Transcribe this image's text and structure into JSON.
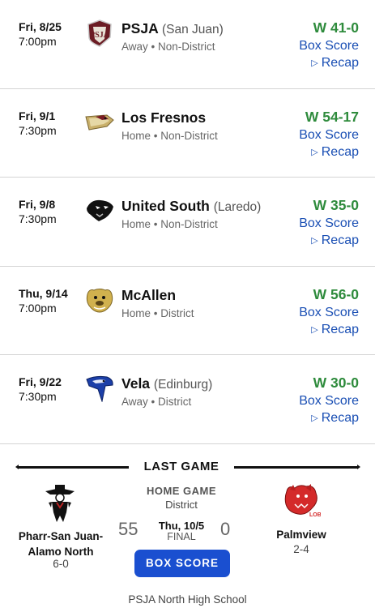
{
  "games": [
    {
      "date": "Fri, 8/25",
      "time": "7:00pm",
      "logo_icon": "psja-bearkat-icon",
      "opponent": "PSJA",
      "city": "(San Juan)",
      "details": "Away • Non-District",
      "result": "W 41-0",
      "box_score": "Box Score",
      "recap": "Recap"
    },
    {
      "date": "Fri, 9/1",
      "time": "7:30pm",
      "logo_icon": "los-fresnos-falcon-icon",
      "opponent": "Los Fresnos",
      "city": "",
      "details": "Home • Non-District",
      "result": "W 54-17",
      "box_score": "Box Score",
      "recap": "Recap"
    },
    {
      "date": "Fri, 9/8",
      "time": "7:30pm",
      "logo_icon": "united-south-panther-icon",
      "opponent": "United South",
      "city": "(Laredo)",
      "details": "Home • Non-District",
      "result": "W 35-0",
      "box_score": "Box Score",
      "recap": "Recap"
    },
    {
      "date": "Thu, 9/14",
      "time": "7:00pm",
      "logo_icon": "mcallen-bulldog-icon",
      "opponent": "McAllen",
      "city": "",
      "details": "Home • District",
      "result": "W 56-0",
      "box_score": "Box Score",
      "recap": "Recap"
    },
    {
      "date": "Fri, 9/22",
      "time": "7:30pm",
      "logo_icon": "vela-sabercat-icon",
      "opponent": "Vela",
      "city": "(Edinburg)",
      "details": "Away • District",
      "result": "W 30-0",
      "box_score": "Box Score",
      "recap": "Recap"
    }
  ],
  "last_game": {
    "title": "LAST GAME",
    "game_type": "HOME GAME",
    "district": "District",
    "home_team": {
      "name": "Pharr-San Juan-Alamo North",
      "record": "6-0",
      "score": "55",
      "logo_icon": "psja-north-raider-icon"
    },
    "away_team": {
      "name": "Palmview",
      "record": "2-4",
      "score": "0",
      "logo_icon": "palmview-lobo-icon"
    },
    "date": "Thu, 10/5",
    "status": "FINAL",
    "box_score_button": "BOX SCORE",
    "footer": "PSJA North High School"
  },
  "colors": {
    "win_green": "#2e8b3c",
    "link_blue": "#1a4fb4",
    "button_blue": "#1a4fd0"
  }
}
